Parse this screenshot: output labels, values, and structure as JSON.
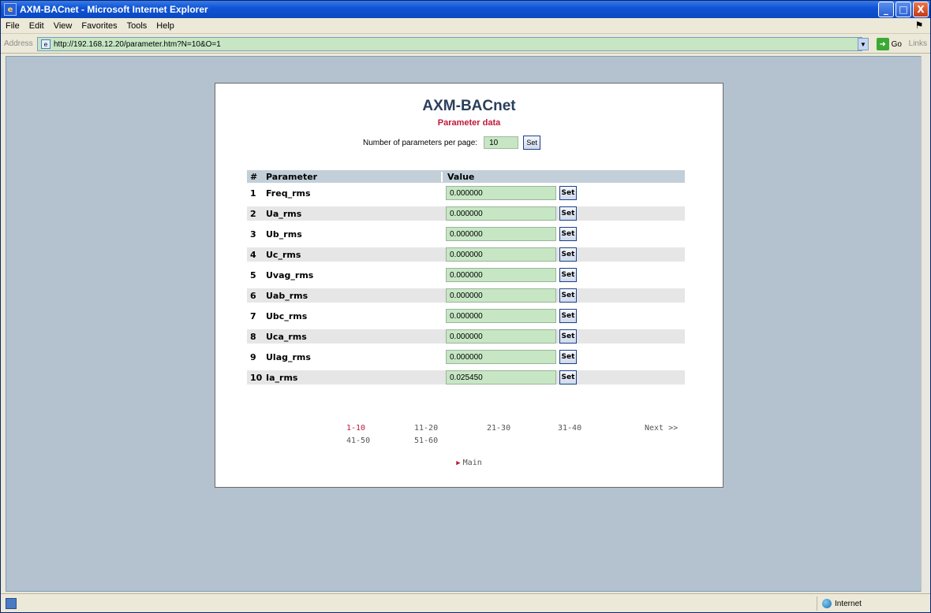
{
  "window": {
    "title": "AXM-BACnet - Microsoft Internet Explorer",
    "controls": [
      "_",
      "□",
      "X"
    ]
  },
  "menu": [
    "File",
    "Edit",
    "View",
    "Favorites",
    "Tools",
    "Help"
  ],
  "address": {
    "label": "Address",
    "url": "http://192.168.12.20/parameter.htm?N=10&O=1",
    "go_label": "Go",
    "links_label": "Links"
  },
  "status": {
    "zone": "Internet"
  },
  "page": {
    "title": "AXM-BACnet",
    "subtitle": "Parameter data",
    "per_page_label": "Number of parameters per page:",
    "per_page_value": "10",
    "set_label": "Set",
    "table": {
      "headers": [
        "#",
        "Parameter",
        "Value"
      ],
      "rows": [
        {
          "num": "1",
          "param": "Freq_rms",
          "value": "0.000000"
        },
        {
          "num": "2",
          "param": "Ua_rms",
          "value": "0.000000"
        },
        {
          "num": "3",
          "param": "Ub_rms",
          "value": "0.000000"
        },
        {
          "num": "4",
          "param": "Uc_rms",
          "value": "0.000000"
        },
        {
          "num": "5",
          "param": "Uvag_rms",
          "value": "0.000000"
        },
        {
          "num": "6",
          "param": "Uab_rms",
          "value": "0.000000"
        },
        {
          "num": "7",
          "param": "Ubc_rms",
          "value": "0.000000"
        },
        {
          "num": "8",
          "param": "Uca_rms",
          "value": "0.000000"
        },
        {
          "num": "9",
          "param": "Ulag_rms",
          "value": "0.000000"
        },
        {
          "num": "10",
          "param": "Ia_rms",
          "value": "0.025450"
        }
      ]
    },
    "pager": [
      "1-10",
      "11-20",
      "21-30",
      "31-40",
      "Next >>",
      "41-50",
      "51-60"
    ],
    "main_link": "Main"
  },
  "colors": {
    "accent": "#c0183a",
    "input_bg": "#c6e6c4",
    "header_bg": "#c2cfd9",
    "desktop_bg": "#b4c2cf"
  }
}
